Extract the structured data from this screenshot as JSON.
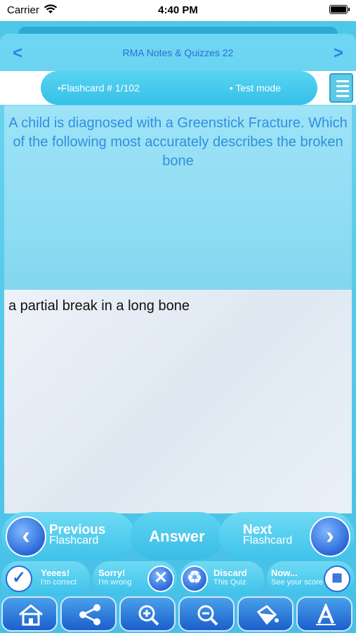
{
  "status_bar": {
    "carrier": "Carrier",
    "time": "4:40 PM"
  },
  "header": {
    "title": "RMA Notes & Quizzes 22",
    "back_icon": "chevron-left-icon",
    "forward_icon": "chevron-right-icon"
  },
  "info_bar": {
    "counter": "•Flashcard #  1/102",
    "mode": "• Test mode",
    "list_icon": "list-icon"
  },
  "flashcard": {
    "question": "A child is diagnosed with a Greenstick Fracture. Which of the following most accurately describes the broken bone",
    "answer": "a partial break in a long bone"
  },
  "controls": {
    "previous_line1": "Previous",
    "previous_line2": "Flashcard",
    "answer_label": "Answer",
    "next_line1": "Next",
    "next_line2": "Flashcard"
  },
  "result_buttons": {
    "correct_line1": "Yeees!",
    "correct_line2": "I'm correct",
    "wrong_line1": "Sorry!",
    "wrong_line2": "I'm wrong",
    "discard_line1": "Discard",
    "discard_line2": "This Quiz",
    "score_line1": "Now...",
    "score_line2": "See your score"
  },
  "toolbar": {
    "icons": [
      "home-icon",
      "share-icon",
      "zoom-in-icon",
      "zoom-out-icon",
      "paint-bucket-icon",
      "font-icon"
    ]
  },
  "colors": {
    "accent_blue": "#2a69d8",
    "cyan_bg": "#4fc8e8",
    "question_text": "#2f8fe0",
    "title_text": "#2a6fd6"
  }
}
